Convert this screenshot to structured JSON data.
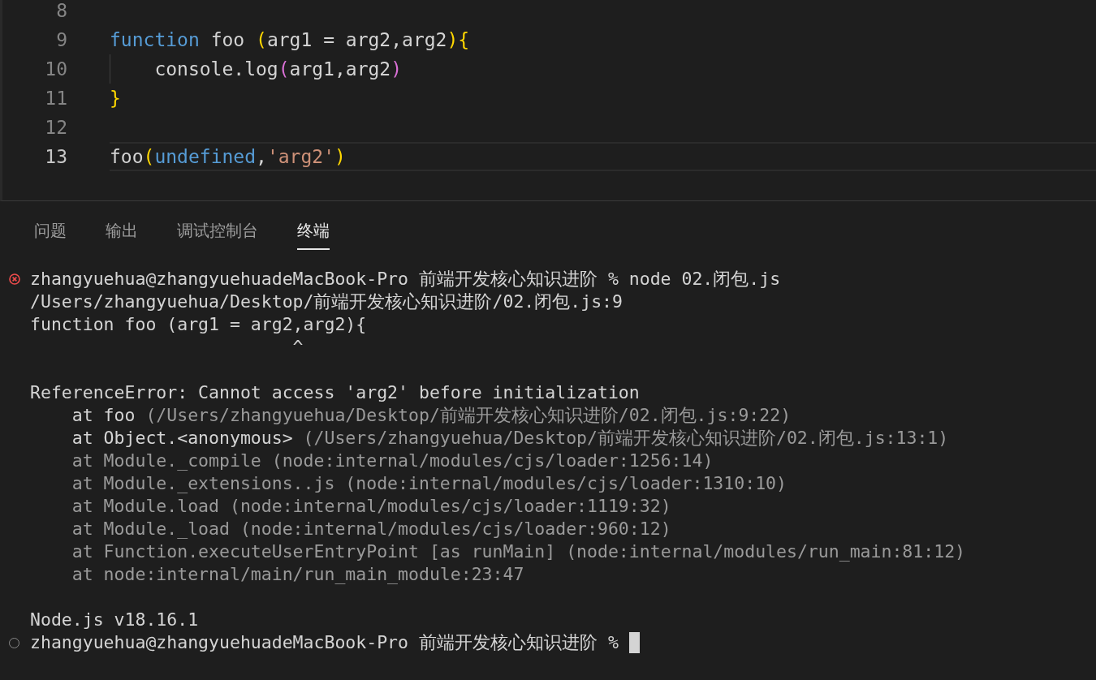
{
  "editor": {
    "lines": [
      {
        "number": "8",
        "current": false,
        "indent_guide": false
      },
      {
        "number": "9",
        "current": false,
        "indent_guide": false,
        "tokens": [
          {
            "text": "function",
            "kind": "keyword"
          },
          {
            "text": " foo ",
            "kind": "plain"
          },
          {
            "text": "(",
            "kind": "bracket"
          },
          {
            "text": "arg1 = arg2,arg2",
            "kind": "plain"
          },
          {
            "text": ")",
            "kind": "bracket"
          },
          {
            "text": "{",
            "kind": "bracket"
          }
        ]
      },
      {
        "number": "10",
        "current": false,
        "indent_guide": true,
        "tokens": [
          {
            "text": "    console.log",
            "kind": "plain"
          },
          {
            "text": "(",
            "kind": "bracket2"
          },
          {
            "text": "arg1,arg2",
            "kind": "plain"
          },
          {
            "text": ")",
            "kind": "bracket2"
          }
        ]
      },
      {
        "number": "11",
        "current": false,
        "indent_guide": false,
        "tokens": [
          {
            "text": "}",
            "kind": "bracket"
          }
        ]
      },
      {
        "number": "12",
        "current": false,
        "indent_guide": false
      },
      {
        "number": "13",
        "current": true,
        "indent_guide": false,
        "tokens": [
          {
            "text": "foo",
            "kind": "plain"
          },
          {
            "text": "(",
            "kind": "bracket"
          },
          {
            "text": "undefined",
            "kind": "keyword"
          },
          {
            "text": ",",
            "kind": "plain"
          },
          {
            "text": "'arg2'",
            "kind": "string"
          },
          {
            "text": ")",
            "kind": "bracket"
          }
        ]
      }
    ]
  },
  "panel": {
    "tabs": [
      {
        "label": "问题",
        "selected": false
      },
      {
        "label": "输出",
        "selected": false
      },
      {
        "label": "调试控制台",
        "selected": false
      },
      {
        "label": "终端",
        "selected": true
      }
    ]
  },
  "terminal": {
    "lines": [
      {
        "kind": "error",
        "space_before": false,
        "parts": [
          {
            "text": "zhangyuehua@zhangyuehuadeMacBook-Pro 前端开发核心知识进阶 % node 02.闭包.js",
            "dim": false
          }
        ]
      },
      {
        "kind": "output",
        "space_before": false,
        "parts": [
          {
            "text": "/Users/zhangyuehua/Desktop/前端开发核心知识进阶/02.闭包.js:9",
            "dim": false
          }
        ]
      },
      {
        "kind": "output",
        "space_before": false,
        "parts": [
          {
            "text": "function foo (arg1 = arg2,arg2){",
            "dim": false
          }
        ]
      },
      {
        "kind": "output",
        "space_before": false,
        "parts": [
          {
            "text": "                         ^",
            "dim": false
          }
        ]
      },
      {
        "kind": "output",
        "space_before": true,
        "parts": [
          {
            "text": "ReferenceError: Cannot access 'arg2' before initialization",
            "dim": false
          }
        ]
      },
      {
        "kind": "output",
        "space_before": false,
        "parts": [
          {
            "text": "    at foo ",
            "dim": false
          },
          {
            "text": "(/Users/zhangyuehua/Desktop/前端开发核心知识进阶/02.闭包.js:9:22)",
            "dim": true
          }
        ]
      },
      {
        "kind": "output",
        "space_before": false,
        "parts": [
          {
            "text": "    at Object.<anonymous> ",
            "dim": false
          },
          {
            "text": "(/Users/zhangyuehua/Desktop/前端开发核心知识进阶/02.闭包.js:13:1)",
            "dim": true
          }
        ]
      },
      {
        "kind": "output",
        "space_before": false,
        "parts": [
          {
            "text": "    at Module._compile (node:internal/modules/cjs/loader:1256:14)",
            "dim": true
          }
        ]
      },
      {
        "kind": "output",
        "space_before": false,
        "parts": [
          {
            "text": "    at Module._extensions..js (node:internal/modules/cjs/loader:1310:10)",
            "dim": true
          }
        ]
      },
      {
        "kind": "output",
        "space_before": false,
        "parts": [
          {
            "text": "    at Module.load (node:internal/modules/cjs/loader:1119:32)",
            "dim": true
          }
        ]
      },
      {
        "kind": "output",
        "space_before": false,
        "parts": [
          {
            "text": "    at Module._load (node:internal/modules/cjs/loader:960:12)",
            "dim": true
          }
        ]
      },
      {
        "kind": "output",
        "space_before": false,
        "parts": [
          {
            "text": "    at Function.executeUserEntryPoint [as runMain] (node:internal/modules/run_main:81:12)",
            "dim": true
          }
        ]
      },
      {
        "kind": "output",
        "space_before": false,
        "parts": [
          {
            "text": "    at node:internal/main/run_main_module:23:47",
            "dim": true
          }
        ]
      },
      {
        "kind": "output",
        "space_before": true,
        "parts": [
          {
            "text": "Node.js v18.16.1",
            "dim": false
          }
        ]
      },
      {
        "kind": "prompt",
        "space_before": false,
        "parts": [
          {
            "text": "zhangyuehua@zhangyuehuadeMacBook-Pro 前端开发核心知识进阶 % ",
            "dim": false
          }
        ],
        "cursor": true
      }
    ]
  }
}
